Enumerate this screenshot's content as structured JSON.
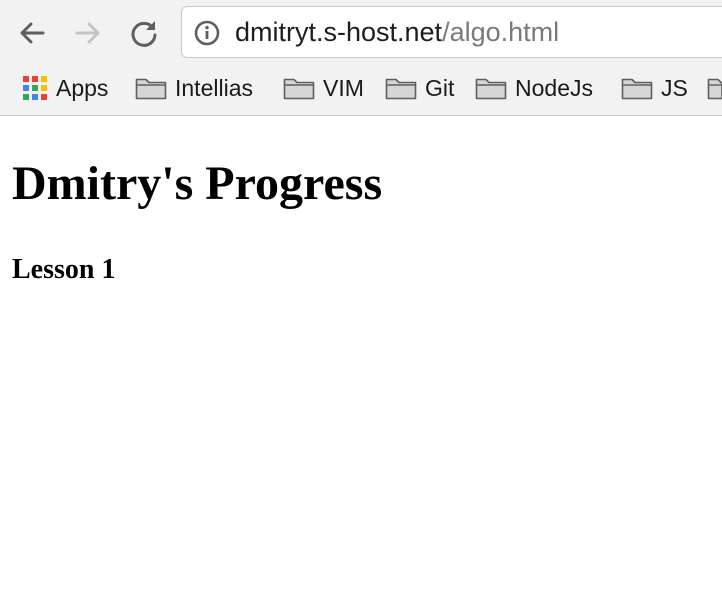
{
  "browser": {
    "url_host": "dmitryt.s-host.net",
    "url_path": "/algo.html",
    "bookmarks": [
      {
        "label": "Apps",
        "icon": "apps-grid-icon"
      },
      {
        "label": "Intellias",
        "icon": "folder-icon"
      },
      {
        "label": "VIM",
        "icon": "folder-icon"
      },
      {
        "label": "Git",
        "icon": "folder-icon"
      },
      {
        "label": "NodeJs",
        "icon": "folder-icon"
      },
      {
        "label": "JS",
        "icon": "folder-icon"
      }
    ]
  },
  "page": {
    "title": "Dmitry's Progress",
    "subtitle": "Lesson 1"
  },
  "colors": {
    "toolbar_bg": "#f2f2f2",
    "url_path": "#7a7a7a",
    "disabled_icon": "#c4c4c4",
    "icon": "#5f5f5f"
  }
}
